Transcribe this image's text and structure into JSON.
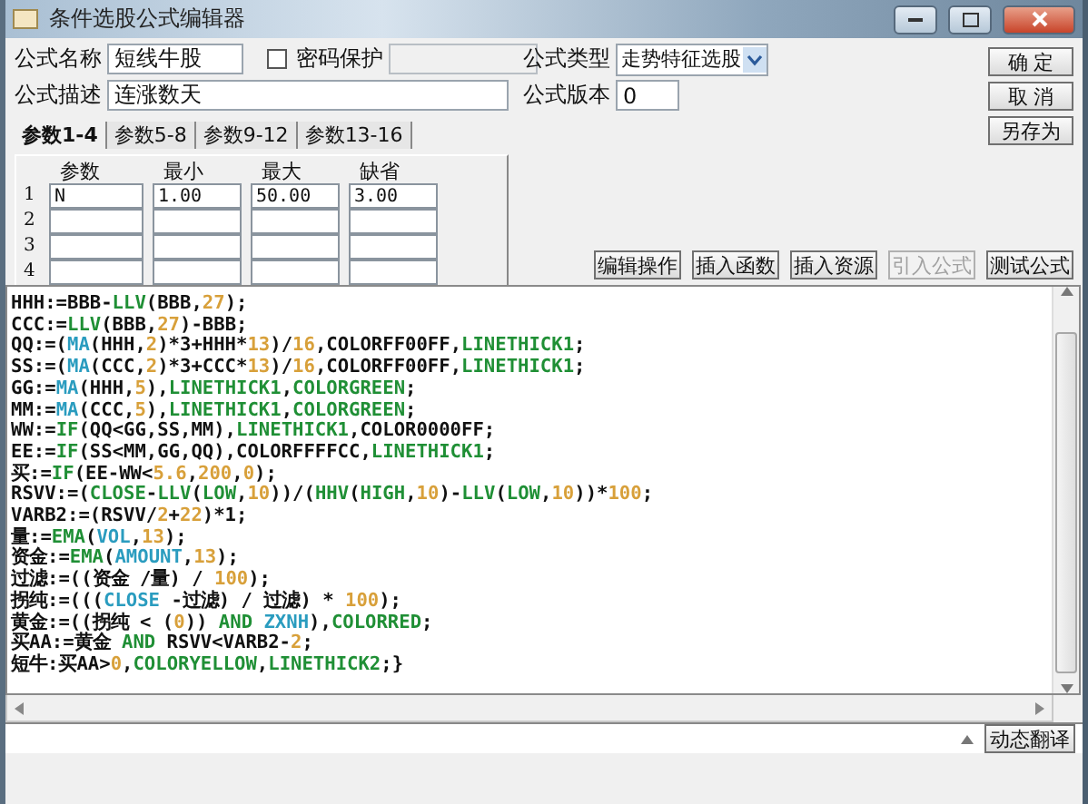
{
  "window": {
    "title": "条件选股公式编辑器"
  },
  "form": {
    "name": {
      "label": "公式名称",
      "value": "短线牛股"
    },
    "password": {
      "label": "密码保护",
      "checked": false
    },
    "description": {
      "label": "公式描述",
      "value": "连涨数天"
    },
    "type": {
      "label": "公式类型",
      "value": "走势特征选股"
    },
    "version": {
      "label": "公式版本",
      "value": "0"
    }
  },
  "side_buttons": [
    {
      "label": "确 定"
    },
    {
      "label": "取 消"
    },
    {
      "label": "另存为"
    }
  ],
  "tabs": [
    {
      "label": "参数1-4",
      "selected": true
    },
    {
      "label": "参数5-8",
      "selected": false
    },
    {
      "label": "参数9-12",
      "selected": false
    },
    {
      "label": "参数13-16",
      "selected": false
    }
  ],
  "params": {
    "columns": [
      "参数",
      "最小",
      "最大",
      "缺省"
    ],
    "rows": [
      {
        "index": "1",
        "values": [
          "N",
          "1.00",
          "50.00",
          "3.00"
        ]
      },
      {
        "index": "2"
      },
      {
        "index": "3"
      },
      {
        "index": "4"
      }
    ]
  },
  "toolbar": [
    {
      "label": "编辑操作",
      "disabled": false
    },
    {
      "label": "插入函数",
      "disabled": false
    },
    {
      "label": "插入资源",
      "disabled": false
    },
    {
      "label": "引入公式",
      "disabled": true
    },
    {
      "label": "测试公式",
      "disabled": false
    }
  ],
  "code_lines": [
    [
      {
        "kind": "plain",
        "text": "HHH:=BBB-"
      },
      {
        "kind": "function",
        "text": "LLV"
      },
      {
        "kind": "plain",
        "text": "(BBB,"
      },
      {
        "kind": "number",
        "text": "27"
      },
      {
        "kind": "plain",
        "text": ");"
      }
    ],
    [
      {
        "kind": "plain",
        "text": "CCC:="
      },
      {
        "kind": "function",
        "text": "LLV"
      },
      {
        "kind": "plain",
        "text": "(BBB,"
      },
      {
        "kind": "number",
        "text": "27"
      },
      {
        "kind": "plain",
        "text": ")-BBB;"
      }
    ],
    [
      {
        "kind": "plain",
        "text": "QQ:=("
      },
      {
        "kind": "constant",
        "text": "MA"
      },
      {
        "kind": "plain",
        "text": "(HHH,"
      },
      {
        "kind": "number",
        "text": "2"
      },
      {
        "kind": "plain",
        "text": ")*3+HHH*"
      },
      {
        "kind": "number",
        "text": "13"
      },
      {
        "kind": "plain",
        "text": ")/"
      },
      {
        "kind": "number",
        "text": "16"
      },
      {
        "kind": "plain",
        "text": ",COLORFF00FF,"
      },
      {
        "kind": "function",
        "text": "LINETHICK1"
      },
      {
        "kind": "plain",
        "text": ";"
      }
    ],
    [
      {
        "kind": "plain",
        "text": "SS:=("
      },
      {
        "kind": "constant",
        "text": "MA"
      },
      {
        "kind": "plain",
        "text": "(CCC,"
      },
      {
        "kind": "number",
        "text": "2"
      },
      {
        "kind": "plain",
        "text": ")*3+CCC*"
      },
      {
        "kind": "number",
        "text": "13"
      },
      {
        "kind": "plain",
        "text": ")/"
      },
      {
        "kind": "number",
        "text": "16"
      },
      {
        "kind": "plain",
        "text": ",COLORFF00FF,"
      },
      {
        "kind": "function",
        "text": "LINETHICK1"
      },
      {
        "kind": "plain",
        "text": ";"
      }
    ],
    [
      {
        "kind": "plain",
        "text": "GG:="
      },
      {
        "kind": "constant",
        "text": "MA"
      },
      {
        "kind": "plain",
        "text": "(HHH,"
      },
      {
        "kind": "number",
        "text": "5"
      },
      {
        "kind": "plain",
        "text": "),"
      },
      {
        "kind": "function",
        "text": "LINETHICK1"
      },
      {
        "kind": "plain",
        "text": ","
      },
      {
        "kind": "function",
        "text": "COLORGREEN"
      },
      {
        "kind": "plain",
        "text": ";"
      }
    ],
    [
      {
        "kind": "plain",
        "text": "MM:="
      },
      {
        "kind": "constant",
        "text": "MA"
      },
      {
        "kind": "plain",
        "text": "(CCC,"
      },
      {
        "kind": "number",
        "text": "5"
      },
      {
        "kind": "plain",
        "text": "),"
      },
      {
        "kind": "function",
        "text": "LINETHICK1"
      },
      {
        "kind": "plain",
        "text": ","
      },
      {
        "kind": "function",
        "text": "COLORGREEN"
      },
      {
        "kind": "plain",
        "text": ";"
      }
    ],
    [
      {
        "kind": "plain",
        "text": "WW:="
      },
      {
        "kind": "function",
        "text": "IF"
      },
      {
        "kind": "plain",
        "text": "(QQ<GG,SS,MM),"
      },
      {
        "kind": "function",
        "text": "LINETHICK1"
      },
      {
        "kind": "plain",
        "text": ",COLOR0000FF;"
      }
    ],
    [
      {
        "kind": "plain",
        "text": "EE:="
      },
      {
        "kind": "function",
        "text": "IF"
      },
      {
        "kind": "plain",
        "text": "(SS<MM,GG,QQ),COLORFFFFCC,"
      },
      {
        "kind": "function",
        "text": "LINETHICK1"
      },
      {
        "kind": "plain",
        "text": ";"
      }
    ],
    [
      {
        "kind": "plain",
        "text": "买:="
      },
      {
        "kind": "function",
        "text": "IF"
      },
      {
        "kind": "plain",
        "text": "(EE-WW<"
      },
      {
        "kind": "number",
        "text": "5.6"
      },
      {
        "kind": "plain",
        "text": ","
      },
      {
        "kind": "number",
        "text": "200"
      },
      {
        "kind": "plain",
        "text": ","
      },
      {
        "kind": "number",
        "text": "0"
      },
      {
        "kind": "plain",
        "text": ");"
      }
    ],
    [
      {
        "kind": "plain",
        "text": "RSVV:=("
      },
      {
        "kind": "function",
        "text": "CLOSE"
      },
      {
        "kind": "plain",
        "text": "-"
      },
      {
        "kind": "function",
        "text": "LLV"
      },
      {
        "kind": "plain",
        "text": "("
      },
      {
        "kind": "function",
        "text": "LOW"
      },
      {
        "kind": "plain",
        "text": ","
      },
      {
        "kind": "number",
        "text": "10"
      },
      {
        "kind": "plain",
        "text": "))/("
      },
      {
        "kind": "function",
        "text": "HHV"
      },
      {
        "kind": "plain",
        "text": "("
      },
      {
        "kind": "function",
        "text": "HIGH"
      },
      {
        "kind": "plain",
        "text": ","
      },
      {
        "kind": "number",
        "text": "10"
      },
      {
        "kind": "plain",
        "text": ")-"
      },
      {
        "kind": "function",
        "text": "LLV"
      },
      {
        "kind": "plain",
        "text": "("
      },
      {
        "kind": "function",
        "text": "LOW"
      },
      {
        "kind": "plain",
        "text": ","
      },
      {
        "kind": "number",
        "text": "10"
      },
      {
        "kind": "plain",
        "text": "))*"
      },
      {
        "kind": "number",
        "text": "100"
      },
      {
        "kind": "plain",
        "text": ";"
      }
    ],
    [
      {
        "kind": "plain",
        "text": "VARB2:=(RSVV/"
      },
      {
        "kind": "number",
        "text": "2"
      },
      {
        "kind": "plain",
        "text": "+"
      },
      {
        "kind": "number",
        "text": "22"
      },
      {
        "kind": "plain",
        "text": ")*1;"
      }
    ],
    [
      {
        "kind": "plain",
        "text": "量:="
      },
      {
        "kind": "function",
        "text": "EMA"
      },
      {
        "kind": "plain",
        "text": "("
      },
      {
        "kind": "constant",
        "text": "VOL"
      },
      {
        "kind": "plain",
        "text": ","
      },
      {
        "kind": "number",
        "text": "13"
      },
      {
        "kind": "plain",
        "text": ");"
      }
    ],
    [
      {
        "kind": "plain",
        "text": "资金:="
      },
      {
        "kind": "function",
        "text": "EMA"
      },
      {
        "kind": "plain",
        "text": "("
      },
      {
        "kind": "constant",
        "text": "AMOUNT"
      },
      {
        "kind": "plain",
        "text": ","
      },
      {
        "kind": "number",
        "text": "13"
      },
      {
        "kind": "plain",
        "text": ");"
      }
    ],
    [
      {
        "kind": "plain",
        "text": "过滤:=((资金 /量) / "
      },
      {
        "kind": "number",
        "text": "100"
      },
      {
        "kind": "plain",
        "text": ");"
      }
    ],
    [
      {
        "kind": "plain",
        "text": "拐纯:=((("
      },
      {
        "kind": "constant",
        "text": "CLOSE"
      },
      {
        "kind": "plain",
        "text": " -过滤) / 过滤) * "
      },
      {
        "kind": "number",
        "text": "100"
      },
      {
        "kind": "plain",
        "text": ");"
      }
    ],
    [
      {
        "kind": "plain",
        "text": "黄金:=((拐纯 < ("
      },
      {
        "kind": "number",
        "text": "0"
      },
      {
        "kind": "plain",
        "text": ")) "
      },
      {
        "kind": "function",
        "text": "AND"
      },
      {
        "kind": "constant",
        "text": " ZXNH"
      },
      {
        "kind": "plain",
        "text": "),"
      },
      {
        "kind": "function",
        "text": "COLORRED"
      },
      {
        "kind": "plain",
        "text": ";"
      }
    ],
    [
      {
        "kind": "plain",
        "text": "买AA:=黄金 "
      },
      {
        "kind": "function",
        "text": "AND"
      },
      {
        "kind": "plain",
        "text": " RSVV<VARB2-"
      },
      {
        "kind": "number",
        "text": "2"
      },
      {
        "kind": "plain",
        "text": ";"
      }
    ],
    [
      {
        "kind": "plain",
        "text": "短牛:买AA>"
      },
      {
        "kind": "number",
        "text": "0"
      },
      {
        "kind": "plain",
        "text": ","
      },
      {
        "kind": "function",
        "text": "COLORYELLOW"
      },
      {
        "kind": "plain",
        "text": ","
      },
      {
        "kind": "function",
        "text": "LINETHICK2"
      },
      {
        "kind": "plain",
        "text": ";}"
      }
    ]
  ],
  "status_button": {
    "label": "动态翻译"
  }
}
